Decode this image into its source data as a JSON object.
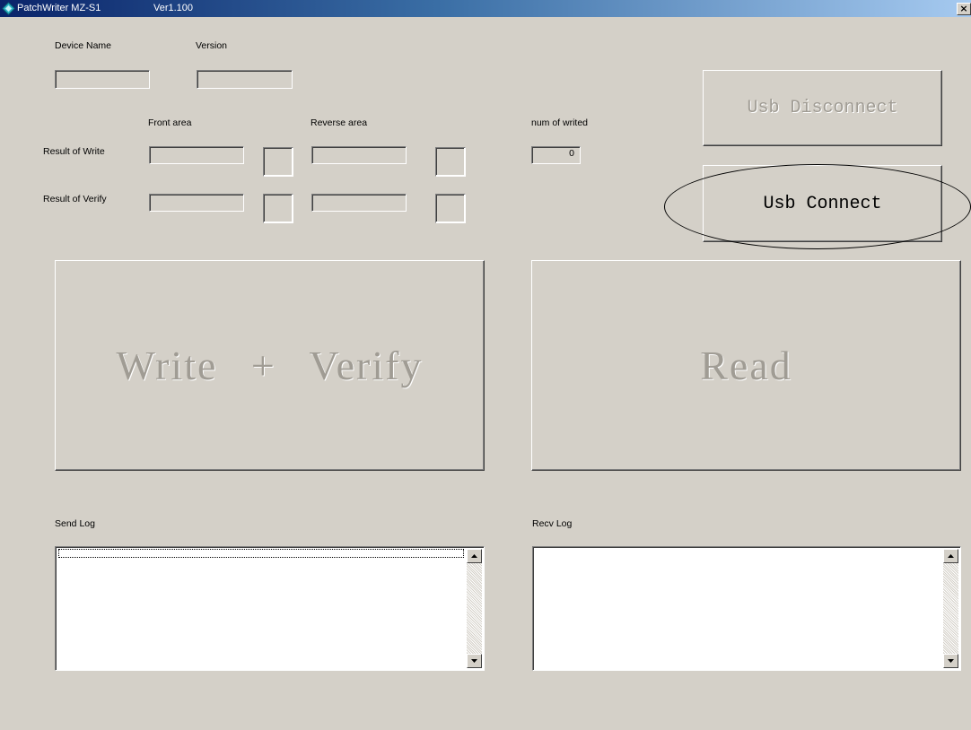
{
  "window": {
    "title": "PatchWriter MZ-S1",
    "version": "Ver1.100",
    "close_label": "×"
  },
  "labels": {
    "device_name": "Device Name",
    "version": "Version",
    "front_area": "Front area",
    "reverse_area": "Reverse area",
    "num_writed": "num of writed",
    "result_write": "Result of Write",
    "result_verify": "Result of Verify",
    "send_log": "Send Log",
    "recv_log": "Recv Log"
  },
  "fields": {
    "device_name": "",
    "version": "",
    "write_front": "",
    "write_reverse": "",
    "verify_front": "",
    "verify_reverse": "",
    "num_writed": "0"
  },
  "buttons": {
    "usb_disconnect": "Usb Disconnect",
    "usb_connect": "Usb Connect",
    "write_verify": "Write + Verify",
    "read": "Read"
  },
  "logs": {
    "send": "",
    "recv": ""
  },
  "colors": {
    "window_bg": "#d4d0c8",
    "titlebar_start": "#0a246a",
    "titlebar_end": "#a6caf0",
    "disabled_text": "#a09c94",
    "annotation": "#000000"
  },
  "icons": {
    "app": "app-diamond-icon",
    "close": "close-icon",
    "scroll_up": "arrow-up-icon",
    "scroll_down": "arrow-down-icon"
  }
}
